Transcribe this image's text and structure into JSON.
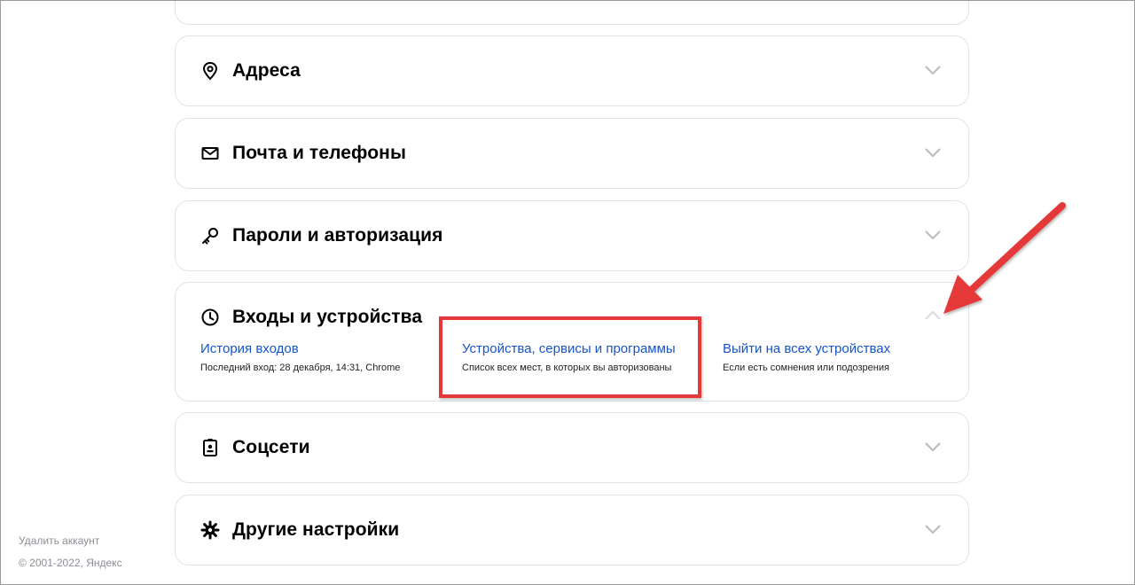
{
  "sections": {
    "addresses": {
      "title": "Адреса"
    },
    "mail": {
      "title": "Почта и телефоны"
    },
    "passwords": {
      "title": "Пароли и авторизация"
    },
    "logins": {
      "title": "Входы и устройства",
      "items": [
        {
          "link": "История входов",
          "desc": "Последний вход: 28 декабря, 14:31, Chrome"
        },
        {
          "link": "Устройства, сервисы и программы",
          "desc": "Список всех мест, в которых вы авторизованы"
        },
        {
          "link": "Выйти на всех устройствах",
          "desc": "Если есть сомнения или подозрения"
        }
      ]
    },
    "social": {
      "title": "Соцсети"
    },
    "other": {
      "title": "Другие настройки"
    }
  },
  "footer": {
    "delete_account": "Удалить аккаунт",
    "copyright": "© 2001-2022, Яндекс"
  },
  "colors": {
    "link": "#1754c8",
    "annotation": "#e53838"
  }
}
